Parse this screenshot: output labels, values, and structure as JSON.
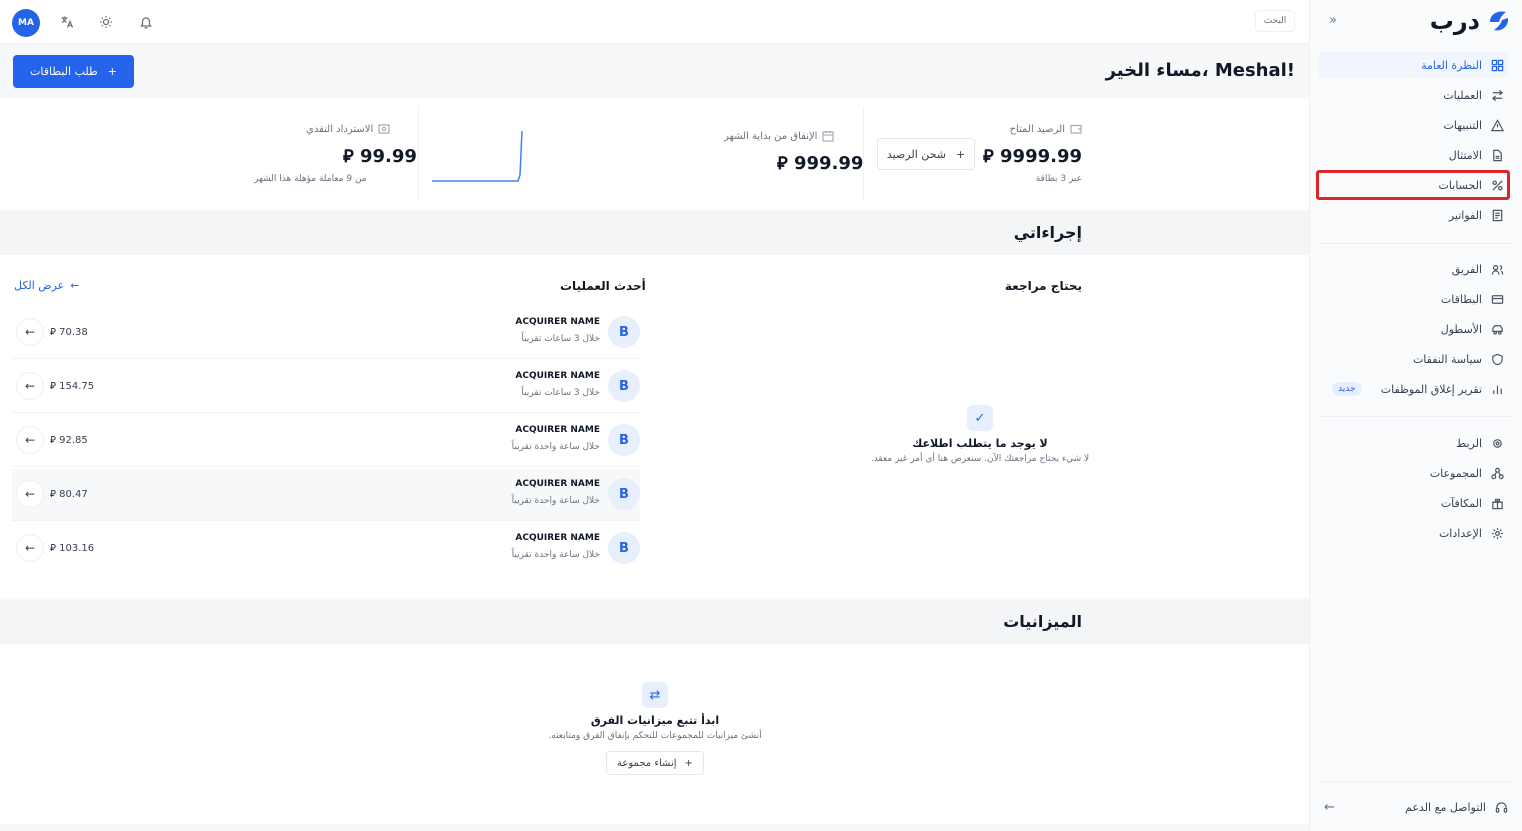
{
  "brand": {
    "name": "درب",
    "accent": "#2563eb"
  },
  "sidebar": {
    "items": [
      {
        "label": "النظرة العامة",
        "icon": "grid-icon"
      },
      {
        "label": "العمليات",
        "icon": "transfer-icon"
      },
      {
        "label": "التنبيهات",
        "icon": "alert-triangle-icon"
      },
      {
        "label": "الامتثال",
        "icon": "document-icon"
      },
      {
        "label": "الحسابات",
        "icon": "accounts-icon"
      },
      {
        "label": "الفواتير",
        "icon": "invoice-icon"
      },
      {
        "label": "الفريق",
        "icon": "team-icon"
      },
      {
        "label": "البطاقات",
        "icon": "card-icon"
      },
      {
        "label": "الأسطول",
        "icon": "fleet-icon"
      },
      {
        "label": "سياسة النفقات",
        "icon": "shield-icon"
      },
      {
        "label": "تقرير إغلاق الموظفات",
        "icon": "chart-icon",
        "badge": "جديد"
      },
      {
        "label": "الربط",
        "icon": "link-icon"
      },
      {
        "label": "المجموعات",
        "icon": "groups-icon"
      },
      {
        "label": "المكافآت",
        "icon": "gift-icon"
      },
      {
        "label": "الإعدادات",
        "icon": "gear-icon"
      }
    ],
    "support_label": "التواصل مع الدعم"
  },
  "topbar": {
    "avatar_initials": "MA",
    "search_chip": "البحث"
  },
  "main": {
    "greeting": "مساء الخير، Meshal!",
    "request_cards_label": "طلب البطاقات",
    "stats": {
      "balance_label": "الرصيد المتاح",
      "balance_value": "9999.99 ⃁",
      "balance_sub": "عبر 3 بطاقة",
      "topup_label": "شحن الرصيد",
      "spend_label": "الإنفاق من بداية الشهر",
      "spend_value": "999.99 ⃁",
      "cashback_label": "الاسترداد النقدي",
      "cashback_value": "99.99 ⃁",
      "cashback_sub": "من 9 معاملة مؤهلة هذا الشهر"
    },
    "actions_title": "إجراءاتي",
    "review": {
      "title": "يحتاج مراجعة",
      "empty_title": "لا يوجد ما يتطلب اطلاعك",
      "empty_desc": "لا شيء يحتاج مراجعتك الآن. سنعرض هنا أي أمر غير معقد."
    },
    "recent": {
      "title": "أحدث العمليات",
      "view_all": "عرض الكل",
      "rows": [
        {
          "name": "ACQUIRER NAME",
          "time": "خلال 3 ساعات تقريباً",
          "amount": "⃁ 70.38"
        },
        {
          "name": "ACQUIRER NAME",
          "time": "خلال 3 ساعات تقريباً",
          "amount": "⃁ 154.75"
        },
        {
          "name": "ACQUIRER NAME",
          "time": "خلال ساعة واحدة تقريباً",
          "amount": "⃁ 92.85"
        },
        {
          "name": "ACQUIRER NAME",
          "time": "خلال ساعة واحدة تقريباً",
          "amount": "⃁ 80.47"
        },
        {
          "name": "ACQUIRER NAME",
          "time": "خلال ساعة واحدة تقريباً",
          "amount": "⃁ 103.16"
        }
      ]
    },
    "budgets": {
      "title": "الميزانيات",
      "empty_title": "ابدأ تتبع ميزانيات الفرق",
      "empty_desc": "أنشئ ميزانيات للمجموعات للتحكم بإنفاق الفرق ومتابعته.",
      "create_label": "إنشاء مجموعة"
    }
  },
  "colors": {
    "primary": "#2563eb",
    "highlight": "#dc2626"
  }
}
